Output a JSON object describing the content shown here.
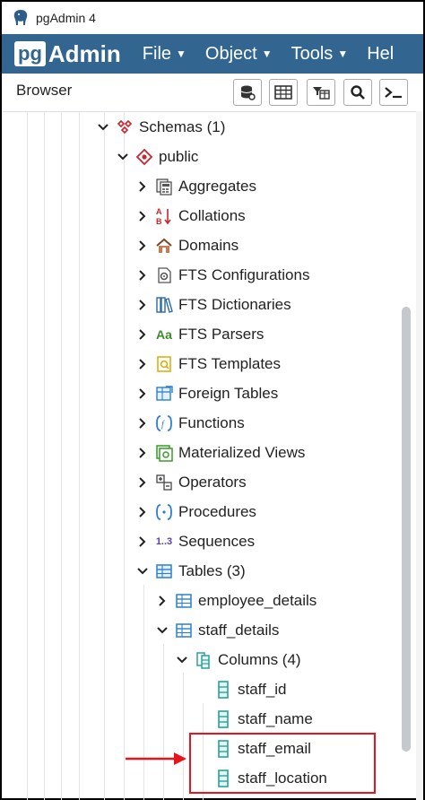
{
  "window": {
    "title": "pgAdmin 4"
  },
  "navbar": {
    "brand_pg": "pg",
    "brand_admin": "Admin",
    "menus": [
      {
        "label": "File"
      },
      {
        "label": "Object"
      },
      {
        "label": "Tools"
      },
      {
        "label": "Hel"
      }
    ]
  },
  "browser": {
    "label": "Browser",
    "toolbar": [
      "database-query-icon",
      "table-view-icon",
      "filter-rows-icon",
      "search-icon",
      "terminal-icon"
    ]
  },
  "tree": {
    "schemas": "Schemas (1)",
    "public": "public",
    "aggregates": "Aggregates",
    "collations": "Collations",
    "domains": "Domains",
    "fts_configurations": "FTS Configurations",
    "fts_dictionaries": "FTS Dictionaries",
    "fts_parsers": "FTS Parsers",
    "fts_templates": "FTS Templates",
    "foreign_tables": "Foreign Tables",
    "functions": "Functions",
    "materialized_views": "Materialized Views",
    "operators": "Operators",
    "procedures": "Procedures",
    "sequences": "Sequences",
    "tables": "Tables (3)",
    "employee_details": "employee_details",
    "staff_details": "staff_details",
    "columns": "Columns (4)",
    "col_staff_id": "staff_id",
    "col_staff_name": "staff_name",
    "col_staff_email": "staff_email",
    "col_staff_location": "staff_location",
    "parsers_icon_text": "Aa",
    "sequences_icon_text": "1..3"
  },
  "colors": {
    "navbar": "#326690",
    "highlight": "#e8141b"
  }
}
